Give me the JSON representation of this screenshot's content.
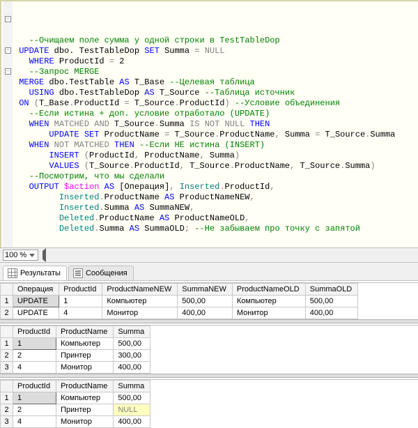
{
  "code": {
    "lines": [
      {
        "indent": 1,
        "spans": [
          {
            "cls": "c",
            "t": "--Очищаем поле сумма у одной строки в TestTableDop"
          }
        ]
      },
      {
        "indent": 0,
        "spans": [
          {
            "cls": "k",
            "t": "UPDATE"
          },
          {
            "t": " dbo. TestTableDop "
          },
          {
            "cls": "k",
            "t": "SET"
          },
          {
            "t": " Summa "
          },
          {
            "cls": "g",
            "t": "="
          },
          {
            "t": " "
          },
          {
            "cls": "g",
            "t": "NULL"
          }
        ]
      },
      {
        "indent": 1,
        "spans": [
          {
            "cls": "k",
            "t": "WHERE"
          },
          {
            "t": " ProductId "
          },
          {
            "cls": "g",
            "t": "="
          },
          {
            "t": " 2"
          }
        ]
      },
      {
        "indent": 1,
        "spans": [
          {
            "cls": "c",
            "t": "--Запрос MERGE"
          }
        ]
      },
      {
        "indent": 0,
        "spans": [
          {
            "cls": "k",
            "t": "MERGE"
          },
          {
            "t": " dbo.TestTable "
          },
          {
            "cls": "k",
            "t": "AS"
          },
          {
            "t": " T_Base "
          },
          {
            "cls": "c",
            "t": "--Целевая таблица"
          }
        ]
      },
      {
        "indent": 1,
        "spans": [
          {
            "cls": "k",
            "t": "USING"
          },
          {
            "t": " dbo.TestTableDop "
          },
          {
            "cls": "k",
            "t": "AS"
          },
          {
            "t": " T_Source "
          },
          {
            "cls": "c",
            "t": "--Таблица источник"
          }
        ]
      },
      {
        "indent": 0,
        "spans": [
          {
            "cls": "k",
            "t": "ON"
          },
          {
            "t": " "
          },
          {
            "cls": "g",
            "t": "("
          },
          {
            "t": "T_Base"
          },
          {
            "cls": "g",
            "t": "."
          },
          {
            "t": "ProductId "
          },
          {
            "cls": "g",
            "t": "="
          },
          {
            "t": " T_Source"
          },
          {
            "cls": "g",
            "t": "."
          },
          {
            "t": "ProductId"
          },
          {
            "cls": "g",
            "t": ")"
          },
          {
            "t": " "
          },
          {
            "cls": "c",
            "t": "--Условие объединения"
          }
        ]
      },
      {
        "indent": 1,
        "spans": [
          {
            "cls": "c",
            "t": "--Если истина + доп. условие отработало (UPDATE)"
          }
        ]
      },
      {
        "indent": 1,
        "spans": [
          {
            "cls": "k",
            "t": "WHEN"
          },
          {
            "t": " "
          },
          {
            "cls": "g",
            "t": "MATCHED"
          },
          {
            "t": " "
          },
          {
            "cls": "g",
            "t": "AND"
          },
          {
            "t": " T_Source"
          },
          {
            "cls": "g",
            "t": "."
          },
          {
            "t": "Summa "
          },
          {
            "cls": "g",
            "t": "IS NOT NULL"
          },
          {
            "t": " "
          },
          {
            "cls": "k",
            "t": "THEN"
          }
        ]
      },
      {
        "indent": 3,
        "spans": [
          {
            "cls": "k",
            "t": "UPDATE"
          },
          {
            "t": " "
          },
          {
            "cls": "k",
            "t": "SET"
          },
          {
            "t": " ProductName "
          },
          {
            "cls": "g",
            "t": "="
          },
          {
            "t": " T_Source"
          },
          {
            "cls": "g",
            "t": "."
          },
          {
            "t": "ProductName"
          },
          {
            "cls": "g",
            "t": ","
          },
          {
            "t": " Summa "
          },
          {
            "cls": "g",
            "t": "="
          },
          {
            "t": " T_Source"
          },
          {
            "cls": "g",
            "t": "."
          },
          {
            "t": "Summa"
          }
        ]
      },
      {
        "indent": 1,
        "spans": [
          {
            "cls": "k",
            "t": "WHEN"
          },
          {
            "t": " "
          },
          {
            "cls": "g",
            "t": "NOT MATCHED"
          },
          {
            "t": " "
          },
          {
            "cls": "k",
            "t": "THEN"
          },
          {
            "t": " "
          },
          {
            "cls": "c",
            "t": "--Если НЕ истина (INSERT)"
          }
        ]
      },
      {
        "indent": 3,
        "spans": [
          {
            "cls": "k",
            "t": "INSERT"
          },
          {
            "t": " "
          },
          {
            "cls": "g",
            "t": "("
          },
          {
            "t": "ProductId"
          },
          {
            "cls": "g",
            "t": ","
          },
          {
            "t": " ProductName"
          },
          {
            "cls": "g",
            "t": ","
          },
          {
            "t": " Summa"
          },
          {
            "cls": "g",
            "t": ")"
          }
        ]
      },
      {
        "indent": 3,
        "spans": [
          {
            "cls": "k",
            "t": "VALUES"
          },
          {
            "t": " "
          },
          {
            "cls": "g",
            "t": "("
          },
          {
            "t": "T_Source"
          },
          {
            "cls": "g",
            "t": "."
          },
          {
            "t": "ProductId"
          },
          {
            "cls": "g",
            "t": ","
          },
          {
            "t": " T_Source"
          },
          {
            "cls": "g",
            "t": "."
          },
          {
            "t": "ProductName"
          },
          {
            "cls": "g",
            "t": ","
          },
          {
            "t": " T_Source"
          },
          {
            "cls": "g",
            "t": "."
          },
          {
            "t": "Summa"
          },
          {
            "cls": "g",
            "t": ")"
          }
        ]
      },
      {
        "indent": 1,
        "spans": [
          {
            "cls": "c",
            "t": "--Посмотрим, что мы сделали"
          }
        ]
      },
      {
        "indent": 1,
        "spans": [
          {
            "cls": "k",
            "t": "OUTPUT"
          },
          {
            "t": " "
          },
          {
            "cls": "fn",
            "t": "$action"
          },
          {
            "t": " "
          },
          {
            "cls": "k",
            "t": "AS"
          },
          {
            "t": " [Операция]"
          },
          {
            "cls": "g",
            "t": ","
          },
          {
            "t": " "
          },
          {
            "cls": "sysobj",
            "t": "Inserted"
          },
          {
            "cls": "g",
            "t": "."
          },
          {
            "t": "ProductId"
          },
          {
            "cls": "g",
            "t": ","
          }
        ]
      },
      {
        "indent": 4,
        "spans": [
          {
            "cls": "sysobj",
            "t": "Inserted"
          },
          {
            "cls": "g",
            "t": "."
          },
          {
            "t": "ProductName "
          },
          {
            "cls": "k",
            "t": "AS"
          },
          {
            "t": " ProductNameNEW"
          },
          {
            "cls": "g",
            "t": ","
          }
        ]
      },
      {
        "indent": 4,
        "spans": [
          {
            "cls": "sysobj",
            "t": "Inserted"
          },
          {
            "cls": "g",
            "t": "."
          },
          {
            "t": "Summa "
          },
          {
            "cls": "k",
            "t": "AS"
          },
          {
            "t": " SummaNEW"
          },
          {
            "cls": "g",
            "t": ","
          }
        ]
      },
      {
        "indent": 4,
        "spans": [
          {
            "cls": "sysobj",
            "t": "Deleted"
          },
          {
            "cls": "g",
            "t": "."
          },
          {
            "t": "ProductName "
          },
          {
            "cls": "k",
            "t": "AS"
          },
          {
            "t": " ProductNameOLD"
          },
          {
            "cls": "g",
            "t": ","
          }
        ]
      },
      {
        "indent": 4,
        "spans": [
          {
            "cls": "sysobj",
            "t": "Deleted"
          },
          {
            "cls": "g",
            "t": "."
          },
          {
            "t": "Summa "
          },
          {
            "cls": "k",
            "t": "AS"
          },
          {
            "t": " SummaOLD"
          },
          {
            "cls": "g",
            "t": ";"
          },
          {
            "t": " "
          },
          {
            "cls": "c",
            "t": "--Не забываем про точку с запятой"
          }
        ]
      }
    ],
    "outline_boxes": [
      {
        "line": 1
      },
      {
        "line": 4
      },
      {
        "line": 6
      }
    ]
  },
  "zoom": {
    "value": "100 %"
  },
  "tabs": {
    "results": "Результаты",
    "messages": "Сообщения"
  },
  "grid1": {
    "headers": [
      "Операция",
      "ProductId",
      "ProductNameNEW",
      "SummaNEW",
      "ProductNameOLD",
      "SummaOLD"
    ],
    "rows": [
      {
        "n": "1",
        "cells": [
          "UPDATE",
          "1",
          "Компьютер",
          "500,00",
          "Компьютер",
          "500,00"
        ],
        "sel": 0
      },
      {
        "n": "2",
        "cells": [
          "UPDATE",
          "4",
          "Монитор",
          "400,00",
          "Монитор",
          "400,00"
        ]
      }
    ]
  },
  "grid2": {
    "headers": [
      "ProductId",
      "ProductName",
      "Summa"
    ],
    "rows": [
      {
        "n": "1",
        "cells": [
          "1",
          "Компьютер",
          "500,00"
        ],
        "sel": 0
      },
      {
        "n": "2",
        "cells": [
          "2",
          "Принтер",
          "300,00"
        ]
      },
      {
        "n": "3",
        "cells": [
          "4",
          "Монитор",
          "400,00"
        ]
      }
    ]
  },
  "grid3": {
    "headers": [
      "ProductId",
      "ProductName",
      "Summa"
    ],
    "rows": [
      {
        "n": "1",
        "cells": [
          "1",
          "Компьютер",
          "500,00"
        ],
        "sel": 0
      },
      {
        "n": "2",
        "cells": [
          "2",
          "Принтер",
          {
            "null": true,
            "t": "NULL"
          }
        ]
      },
      {
        "n": "3",
        "cells": [
          "4",
          "Монитор",
          "400,00"
        ]
      }
    ]
  }
}
